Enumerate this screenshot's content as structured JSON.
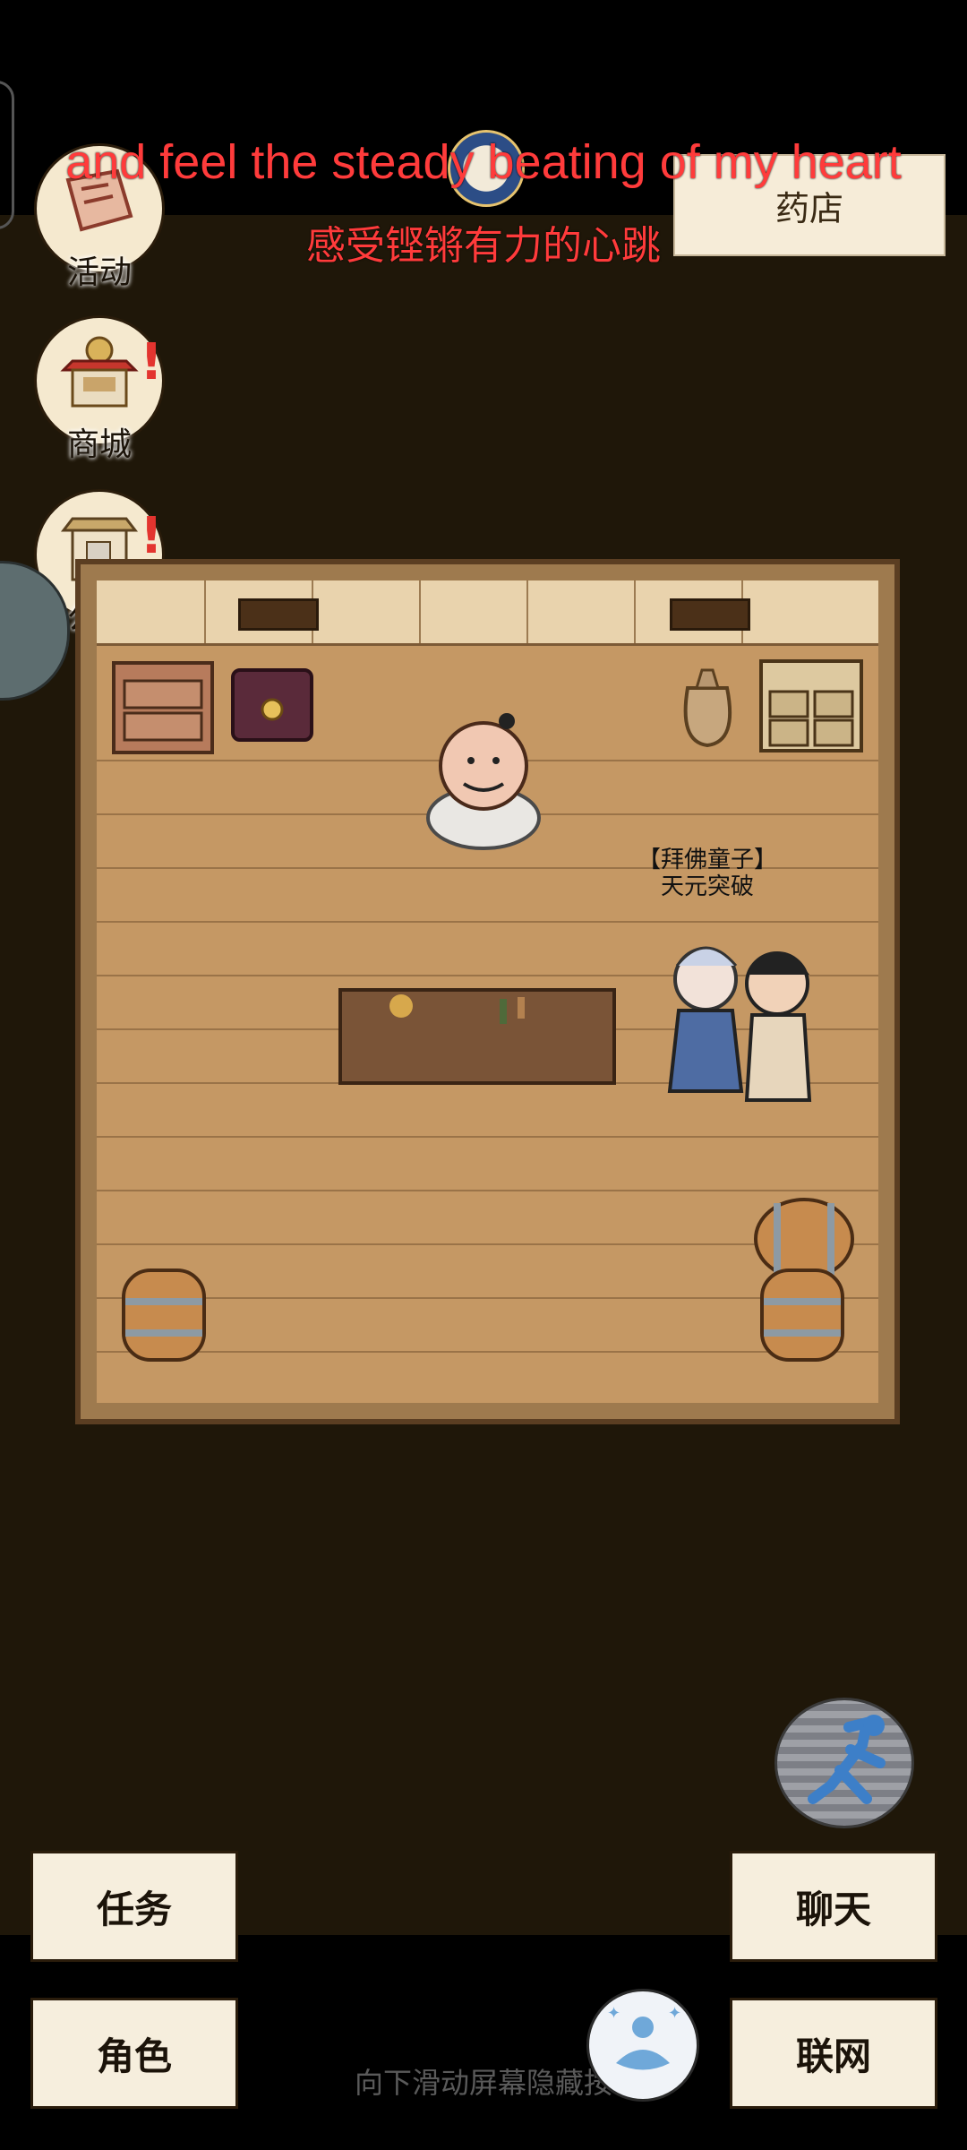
{
  "subtitles": {
    "english": "and feel the steady beating of my heart",
    "chinese": "感受铿锵有力的心跳"
  },
  "left_menu": [
    {
      "label": "活动",
      "icon": "event-scroll-icon",
      "badge": ""
    },
    {
      "label": "商城",
      "icon": "shop-stall-icon",
      "badge": "!"
    },
    {
      "label": "公告",
      "icon": "notice-board-icon",
      "badge": "!"
    }
  ],
  "location_sign": "药店",
  "npc_name_tag": {
    "title": "【拜佛童子】",
    "name": "天元突破"
  },
  "bottom_buttons": {
    "left_top": "任务",
    "left_bottom": "角色",
    "right_top": "聊天",
    "right_bottom": "联网"
  },
  "hint_text": "向下滑动屏幕隐藏按",
  "colors": {
    "background": "#1f1709",
    "subtitle": "#ff3b3b",
    "badge": "#e3342f",
    "button_face": "#f6eedd"
  }
}
